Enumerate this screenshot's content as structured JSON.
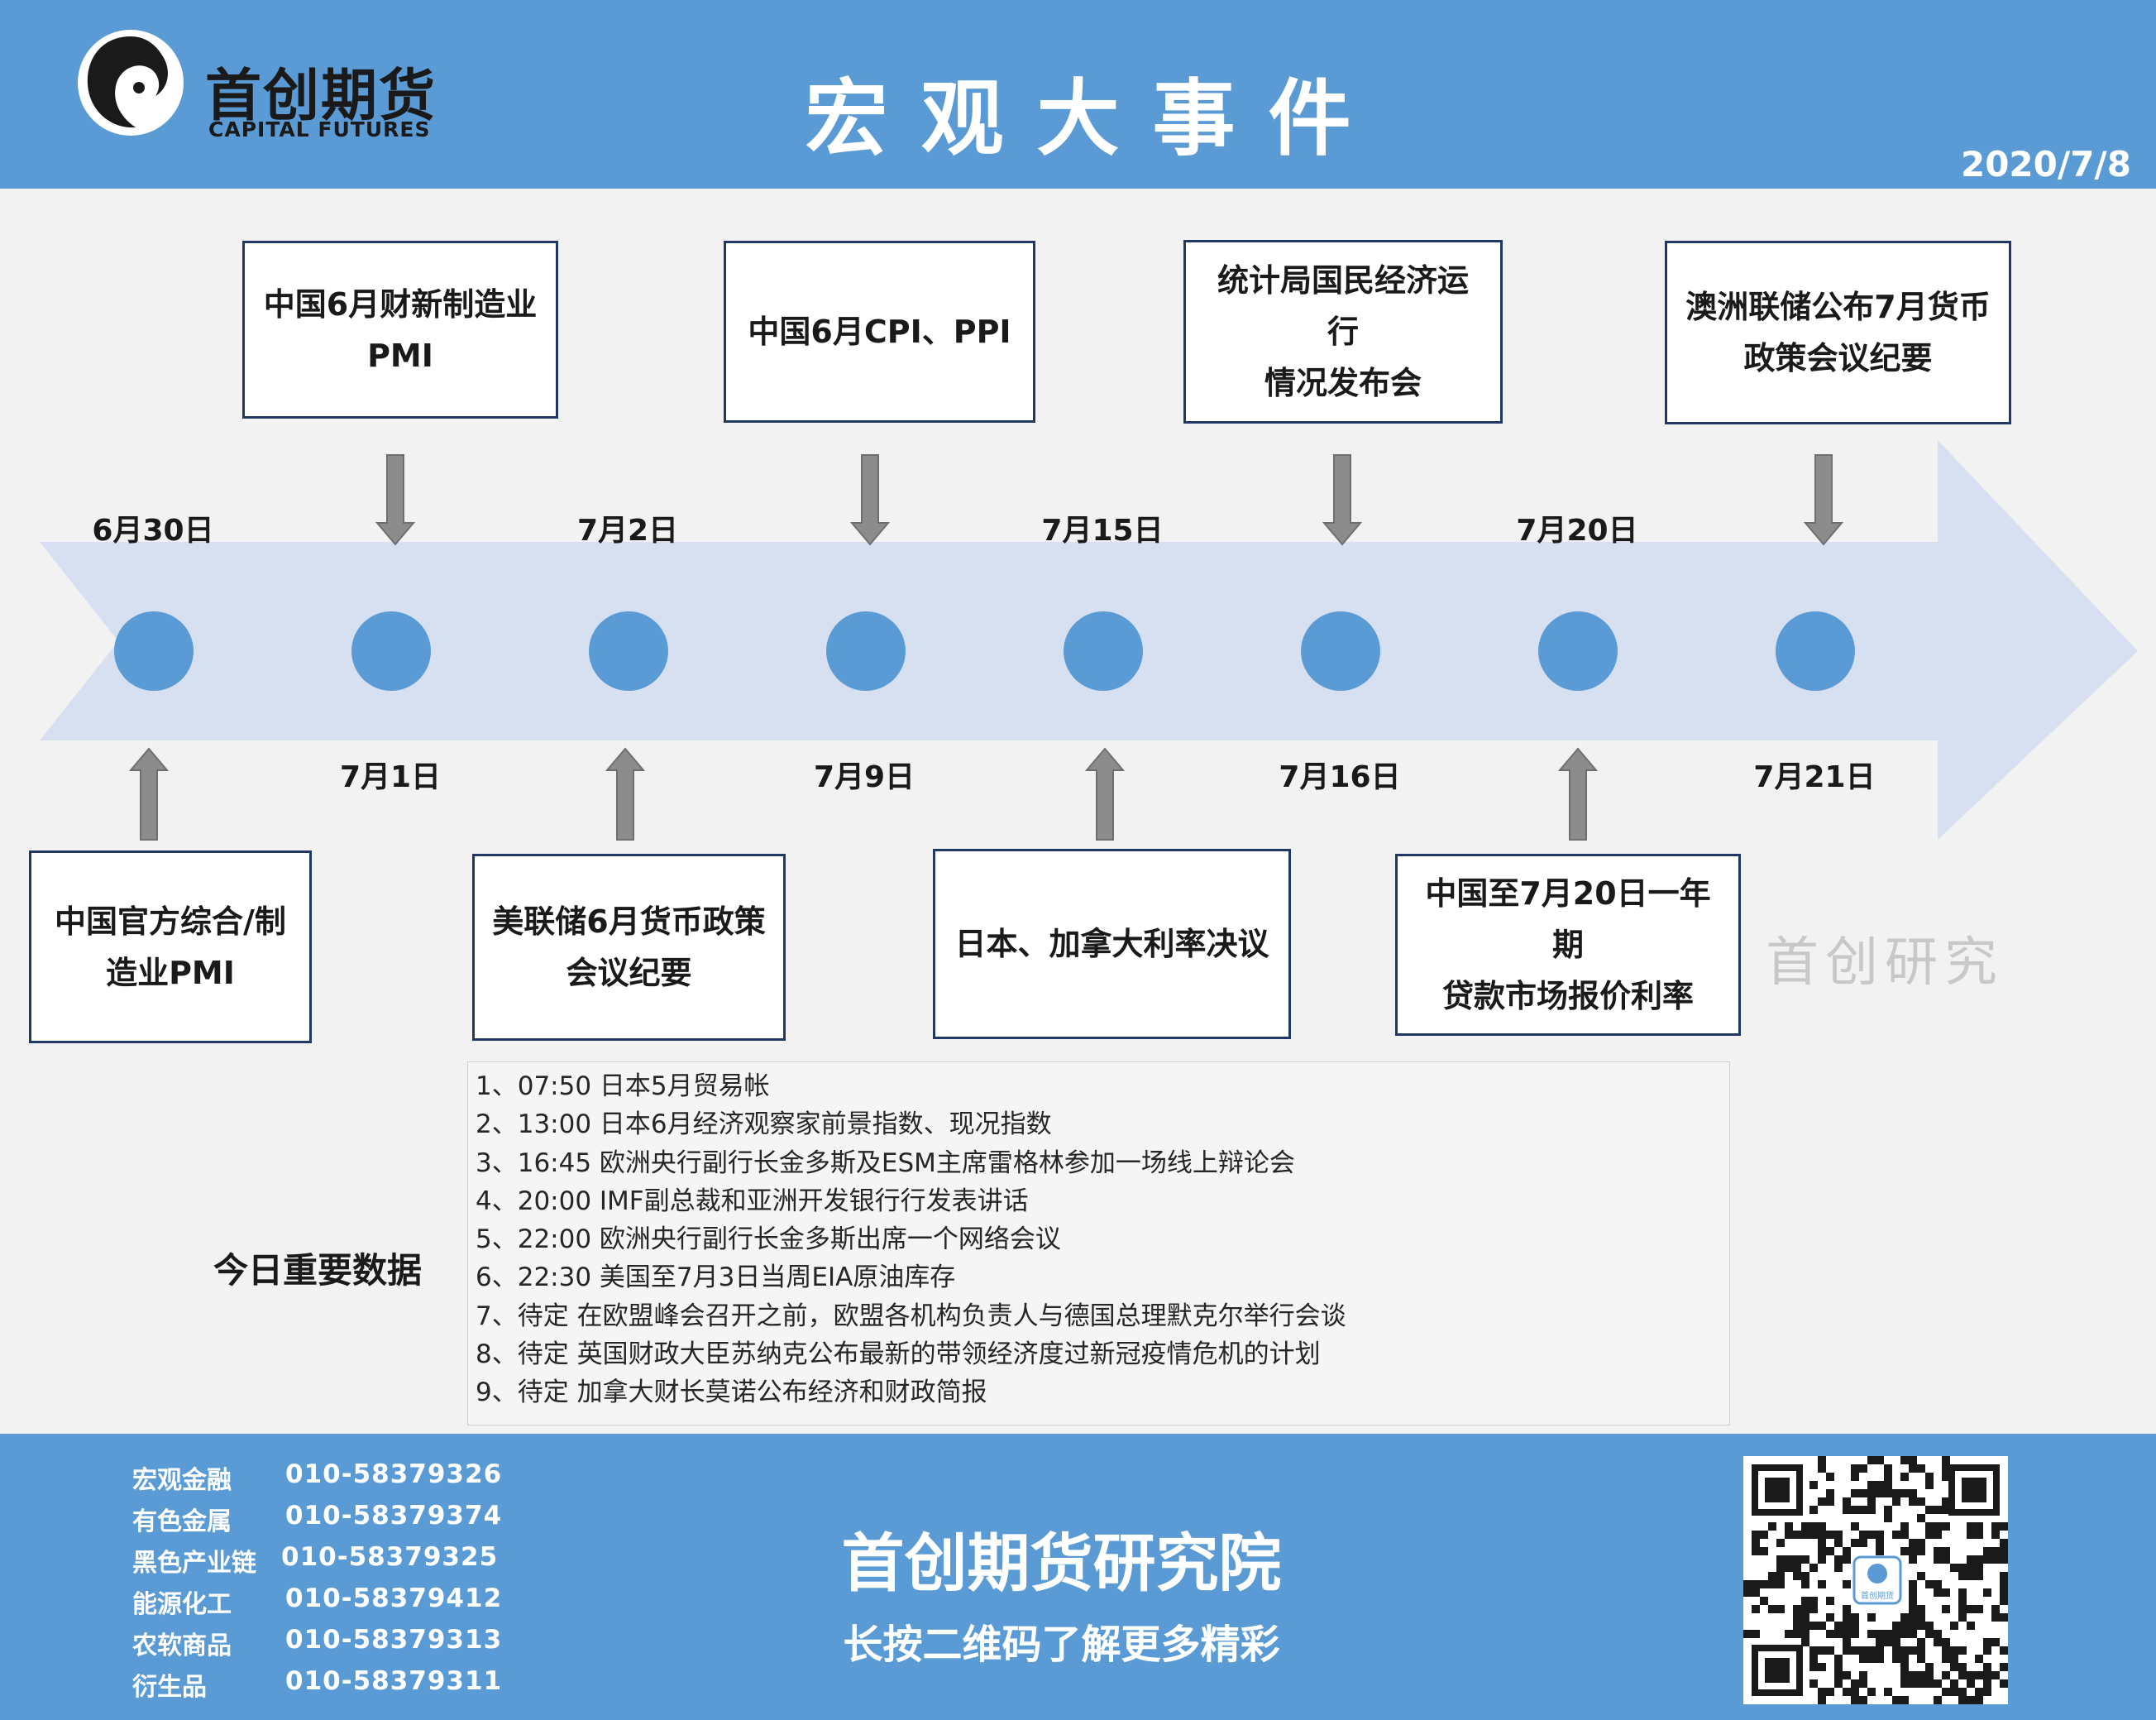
{
  "header": {
    "logo_cn": "首创期货",
    "logo_en": "CAPITAL FUTURES",
    "title": "宏观大事件",
    "date": "2020/7/8"
  },
  "timeline": {
    "dates": [
      "6月30日",
      "7月1日",
      "7月2日",
      "7月9日",
      "7月15日",
      "7月16日",
      "7月20日",
      "7月21日"
    ],
    "top_events": [
      {
        "line1": "中国6月财新制造业",
        "line2": "PMI"
      },
      {
        "line1": "中国6月CPI、PPI",
        "line2": ""
      },
      {
        "line1": "统计局国民经济运行",
        "line2": "情况发布会"
      },
      {
        "line1": "澳洲联储公布7月货币",
        "line2": "政策会议纪要"
      }
    ],
    "bottom_events": [
      {
        "line1": "中国官方综合/制",
        "line2": "造业PMI"
      },
      {
        "line1": "美联储6月货币政策",
        "line2": "会议纪要"
      },
      {
        "line1": "日本、加拿大利率决议",
        "line2": ""
      },
      {
        "line1": "中国至7月20日一年期",
        "line2": "贷款市场报价利率"
      }
    ]
  },
  "watermark": "首创研究",
  "today_data": {
    "label": "今日重要数据",
    "items": [
      "1、07:50 日本5月贸易帐",
      "2、13:00 日本6月经济观察家前景指数、现况指数",
      "3、16:45 欧洲央行副行长金多斯及ESM主席雷格林参加一场线上辩论会",
      "4、20:00 IMF副总裁和亚洲开发银行行发表讲话",
      "5、22:00 欧洲央行副行长金多斯出席一个网络会议",
      "6、22:30 美国至7月3日当周EIA原油库存",
      "7、待定 在欧盟峰会召开之前，欧盟各机构负责人与德国总理默克尔举行会谈",
      "8、待定 英国财政大臣苏纳克公布最新的带领经济度过新冠疫情危机的计划",
      "9、待定 加拿大财长莫诺公布经济和财政简报"
    ]
  },
  "footer": {
    "contacts": [
      {
        "name": "宏观金融",
        "phone": "010-58379326"
      },
      {
        "name": "有色金属",
        "phone": "010-58379374"
      },
      {
        "name": "黑色产业链",
        "phone": "010-58379325"
      },
      {
        "name": "能源化工",
        "phone": "010-58379412"
      },
      {
        "name": "农软商品",
        "phone": "010-58379313"
      },
      {
        "name": "衍生品",
        "phone": "010-58379311"
      }
    ],
    "institute": "首创期货研究院",
    "slogan": "长按二维码了解更多精彩",
    "qr_logo_text": "首创期货"
  },
  "colors": {
    "header_blue": "#5b9bd5",
    "arrow_fill": "#d6e0f0",
    "dot_blue": "#5b9bd5",
    "box_border": "#1f3864"
  }
}
